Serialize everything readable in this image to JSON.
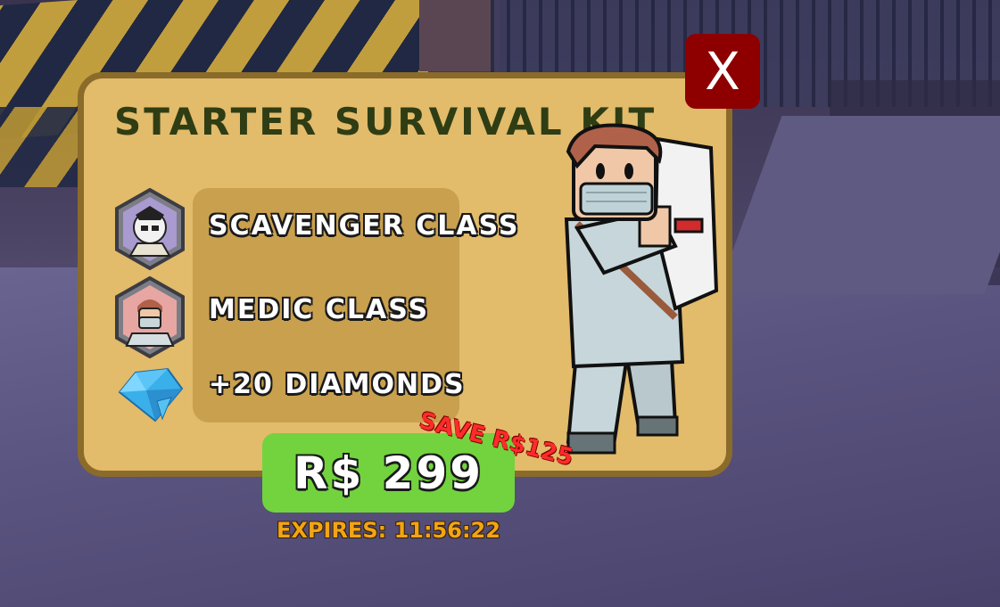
{
  "popup": {
    "title": "STARTER SURVIVAL KIT",
    "close_label": "X",
    "items": [
      {
        "label": "SCAVENGER CLASS",
        "icon": "scavenger-class-icon"
      },
      {
        "label": "MEDIC CLASS",
        "icon": "medic-class-icon"
      },
      {
        "label": "+20 DIAMONDS",
        "icon": "diamond-icon"
      }
    ],
    "price_label": "R$ 299",
    "save_label": "SAVE R$125",
    "expires_label": "EXPIRES: 11:56:22"
  },
  "colors": {
    "card_bg": "#e2bb6b",
    "card_border": "#8a6b2a",
    "close_bg": "#8e0000",
    "price_bg": "#72d33e",
    "save_text": "#ff2b2b",
    "expires_text": "#f2a514",
    "title_text": "#2f3d14"
  }
}
